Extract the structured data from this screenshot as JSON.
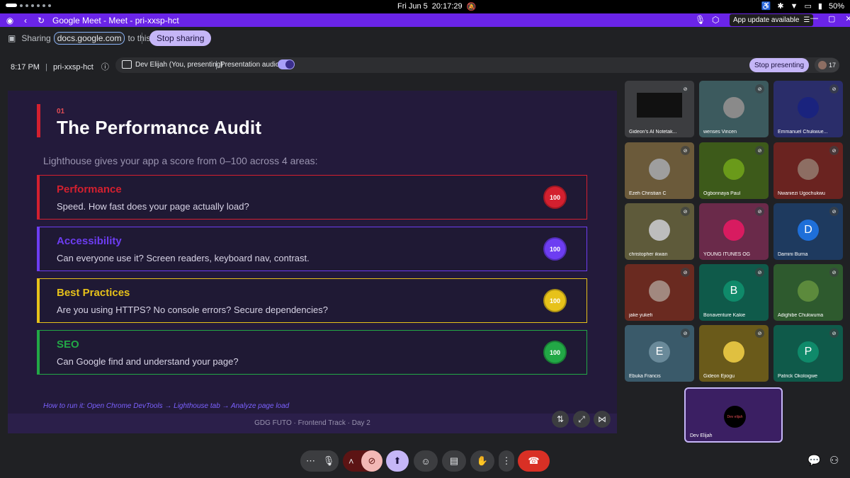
{
  "status_bar": {
    "date": "Fri Jun 5",
    "time": "20:17:29",
    "battery": "50%"
  },
  "browser": {
    "tab_title": "Google Meet - Meet - pri-xxsp-hct",
    "app_update": "App update available"
  },
  "share_bar": {
    "prefix": "Sharing",
    "source": "docs.google.com",
    "suffix": "to this tab",
    "stop_sharing": "Stop sharing"
  },
  "meeting": {
    "time": "8:17 PM",
    "code": "pri-xxsp-hct",
    "presenter": "Dev Elijah (You, presenting)",
    "presentation_audio": "Presentation audio",
    "stop_presenting": "Stop presenting",
    "participant_count": "17"
  },
  "slide": {
    "number": "01",
    "title": "The Performance Audit",
    "lead": "Lighthouse gives your app a score from 0–100 across 4 areas:",
    "cards": [
      {
        "title": "Performance",
        "desc": "Speed. How fast does your page actually load?",
        "score": "100",
        "color": "#d3202f"
      },
      {
        "title": "Accessibility",
        "desc": "Can everyone use it? Screen readers, keyboard nav, contrast.",
        "score": "100",
        "color": "#6d3df2"
      },
      {
        "title": "Best Practices",
        "desc": "Are you using HTTPS? No console errors? Secure dependencies?",
        "score": "100",
        "color": "#e7c21a"
      },
      {
        "title": "SEO",
        "desc": "Can Google find and understand your page?",
        "score": "100",
        "color": "#22a846"
      }
    ],
    "howto": "How to run it: Open Chrome DevTools → Lighthouse tab → Analyze page load",
    "footer": "GDG FUTO  ·  Frontend Track  ·  Day 2"
  },
  "participants": [
    {
      "name": "Gideon's AI Notetak...",
      "bg": "#3c3d40",
      "avatar": "",
      "avcolor": ""
    },
    {
      "name": "wenses Vincen",
      "bg": "#3c5a5e",
      "avatar": "",
      "avcolor": "#8a8a8a"
    },
    {
      "name": "Emmanuel Chukwue...",
      "bg": "#2a2d6a",
      "avatar": "",
      "avcolor": "#1a237e"
    },
    {
      "name": "Ezeh Christian C",
      "bg": "#6b5a3a",
      "avatar": "",
      "avcolor": "#9e9e9e"
    },
    {
      "name": "Ogbonnaya Paul",
      "bg": "#3d5a1a",
      "avatar": "",
      "avcolor": "#6a9a1a"
    },
    {
      "name": "Nwaniezi Ugochukwu",
      "bg": "#6a2320",
      "avatar": "",
      "avcolor": "#8d6e63"
    },
    {
      "name": "christopher ikwan",
      "bg": "#5e5a3a",
      "avatar": "",
      "avcolor": "#bdbdbd"
    },
    {
      "name": "YOUNG ITUNES OG",
      "bg": "#6a2a4a",
      "avatar": "",
      "avcolor": "#d81b60"
    },
    {
      "name": "Damini Burna",
      "bg": "#1e3a5f",
      "avatar": "D",
      "avcolor": "#1e6fd9"
    },
    {
      "name": "jake yukefi",
      "bg": "#6a2a20",
      "avatar": "",
      "avcolor": "#a1887f"
    },
    {
      "name": "Bonaventure Kakie",
      "bg": "#0f5a4a",
      "avatar": "B",
      "avcolor": "#0f8a6a"
    },
    {
      "name": "Adighibe Chukwuma",
      "bg": "#2e5a2e",
      "avatar": "",
      "avcolor": "#5c8a3c"
    },
    {
      "name": "Ebuka Francis",
      "bg": "#3a5a6a",
      "avatar": "E",
      "avcolor": "#6a8a9a"
    },
    {
      "name": "Gideon Ejiogu",
      "bg": "#6a5a1a",
      "avatar": "",
      "avcolor": "#e0c040"
    },
    {
      "name": "Patrick Okoloigwe",
      "bg": "#0f5a4a",
      "avatar": "P",
      "avcolor": "#0f8a6a"
    }
  ],
  "self": {
    "name": "Dev Elijah",
    "logo": "Dev elijah"
  }
}
